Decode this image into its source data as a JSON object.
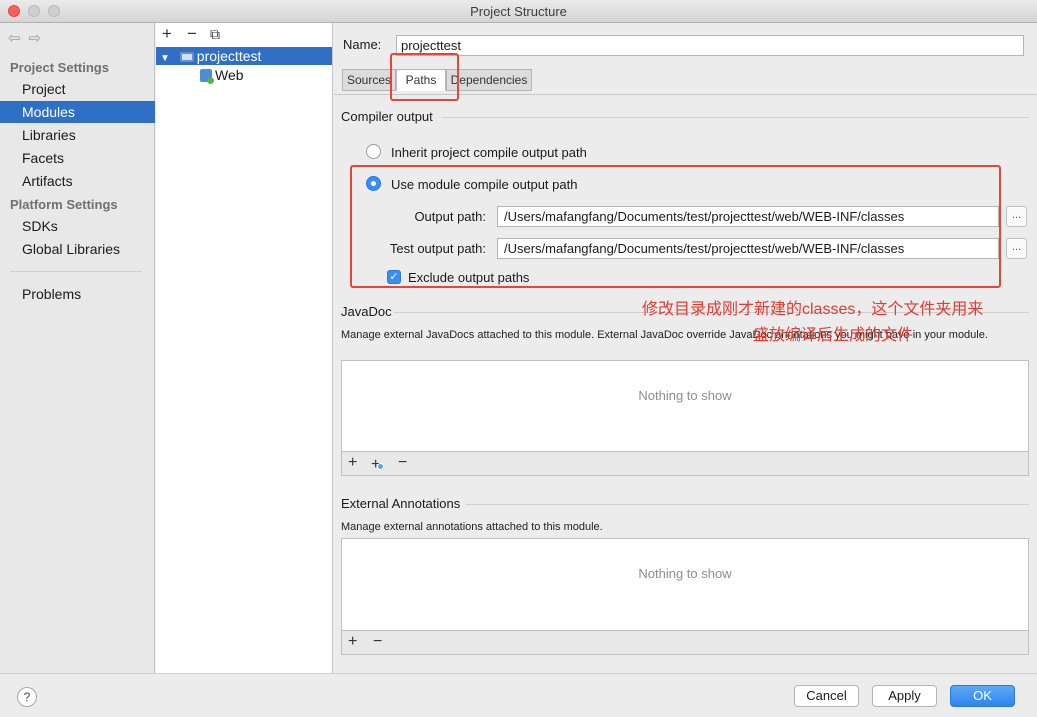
{
  "window": {
    "title": "Project Structure"
  },
  "sidebar": {
    "nav_icons": [
      "back-arrow-icon",
      "forward-arrow-icon"
    ],
    "section_project_settings": "Project Settings",
    "project_items": [
      "Project",
      "Modules",
      "Libraries",
      "Facets",
      "Artifacts"
    ],
    "section_platform_settings": "Platform Settings",
    "platform_items": [
      "SDKs",
      "Global Libraries"
    ],
    "other_items": [
      "Problems"
    ],
    "selected": "Modules"
  },
  "tree": {
    "toolbar": {
      "add": "+",
      "remove": "−",
      "copy": "⧉"
    },
    "nodes": [
      {
        "label": "projecttest",
        "expanded_glyph": "▼",
        "icon": "folder-icon"
      },
      {
        "label": "Web",
        "icon": "web-icon"
      }
    ]
  },
  "module": {
    "name_label": "Name:",
    "name_value": "projecttest",
    "tabs": [
      "Sources",
      "Paths",
      "Dependencies"
    ],
    "active_tab": "Paths"
  },
  "compiler_output": {
    "title": "Compiler output",
    "inherit_label": "Inherit project compile output path",
    "use_module_label": "Use module compile output path",
    "selected_option": "use_module",
    "output_path_label": "Output path:",
    "output_path_value": "/Users/mafangfang/Documents/test/projecttest/web/WEB-INF/classes",
    "test_output_path_label": "Test output path:",
    "test_output_path_value": "/Users/mafangfang/Documents/test/projecttest/web/WEB-INF/classes",
    "browse_label": "...",
    "exclude_label": "Exclude output paths",
    "exclude_checked": true
  },
  "javadoc": {
    "title": "JavaDoc",
    "description": "Manage external JavaDocs attached to this module. External JavaDoc override JavaDoc annotations you might have in your module.",
    "empty_text": "Nothing to show",
    "toolbar": {
      "add": "+",
      "add_url": "+",
      "remove": "−"
    }
  },
  "external_annotations": {
    "title": "External Annotations",
    "description": "Manage external annotations attached to this module.",
    "empty_text": "Nothing to show",
    "toolbar": {
      "add": "+",
      "remove": "−"
    }
  },
  "annotation": {
    "line1": "修改目录成刚才新建的classes，这个文件夹用来",
    "line2": "盛放编译后生成的文件",
    "color": "#e43a2f"
  },
  "buttons": {
    "help": "?",
    "cancel": "Cancel",
    "apply": "Apply",
    "ok": "OK"
  },
  "colors": {
    "selection": "#2f6fc6",
    "accent": "#3b8df2",
    "annotation_red": "#e2473c"
  }
}
